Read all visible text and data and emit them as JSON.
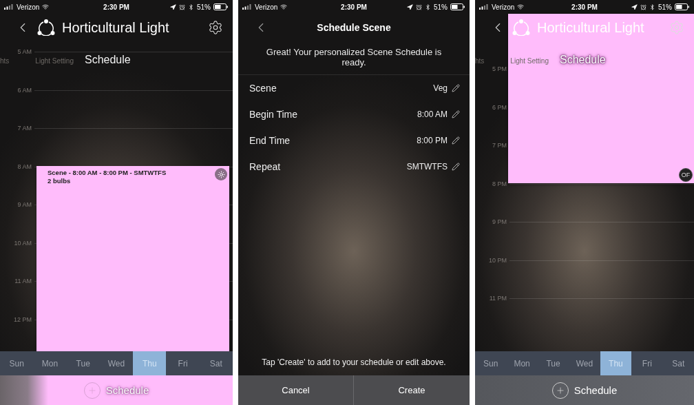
{
  "screens": [
    {
      "kind": "calendar",
      "status_bar": {
        "carrier": "Verizon",
        "time": "2:30 PM",
        "battery": "51%"
      },
      "title": "Horticultural Light",
      "tabs": [
        {
          "label": "hts",
          "selected": false
        },
        {
          "label": "Light Setting",
          "selected": false
        },
        {
          "label": "Schedule",
          "selected": true
        }
      ],
      "hours": [
        "5 AM",
        "6 AM",
        "7 AM",
        "8 AM",
        "9 AM",
        "10 AM",
        "11 AM",
        "12 PM"
      ],
      "event": {
        "kind": "start",
        "title": "Scene - 8:00 AM - 8:00 PM -  SMTWTFS",
        "subtitle": "2 bulbs"
      },
      "days": [
        {
          "label": "Sun",
          "selected": false
        },
        {
          "label": "Mon",
          "selected": false
        },
        {
          "label": "Tue",
          "selected": false
        },
        {
          "label": "Wed",
          "selected": false
        },
        {
          "label": "Thu",
          "selected": true
        },
        {
          "label": "Fri",
          "selected": false
        },
        {
          "label": "Sat",
          "selected": false
        }
      ],
      "add_button": "Schedule"
    },
    {
      "kind": "form",
      "status_bar": {
        "carrier": "Verizon",
        "time": "2:30 PM",
        "battery": "51%"
      },
      "title": "Schedule Scene",
      "message": "Great! Your personalized Scene Schedule is ready.",
      "rows": [
        {
          "label": "Scene",
          "value": "Veg"
        },
        {
          "label": "Begin Time",
          "value": "8:00 AM"
        },
        {
          "label": "End Time",
          "value": "8:00 PM"
        },
        {
          "label": "Repeat",
          "value": "SMTWTFS"
        }
      ],
      "hint": "Tap 'Create' to add to your schedule or edit above.",
      "buttons": [
        "Cancel",
        "Create"
      ]
    },
    {
      "kind": "calendar",
      "status_bar": {
        "carrier": "Verizon",
        "time": "2:30 PM",
        "battery": "51%"
      },
      "title": "Horticultural Light",
      "tabs": [
        {
          "label": "hts",
          "selected": false
        },
        {
          "label": "Light Setting",
          "selected": false
        },
        {
          "label": "Schedule",
          "selected": true
        }
      ],
      "hours": [
        "5 PM",
        "6 PM",
        "7 PM",
        "8 PM",
        "9 PM",
        "10 PM",
        "11 PM"
      ],
      "event": {
        "kind": "end",
        "badge": "OF"
      },
      "days": [
        {
          "label": "Sun",
          "selected": false
        },
        {
          "label": "Mon",
          "selected": false
        },
        {
          "label": "Tue",
          "selected": false
        },
        {
          "label": "Wed",
          "selected": false
        },
        {
          "label": "Thu",
          "selected": true
        },
        {
          "label": "Fri",
          "selected": false
        },
        {
          "label": "Sat",
          "selected": false
        }
      ],
      "add_button": "Schedule"
    }
  ]
}
